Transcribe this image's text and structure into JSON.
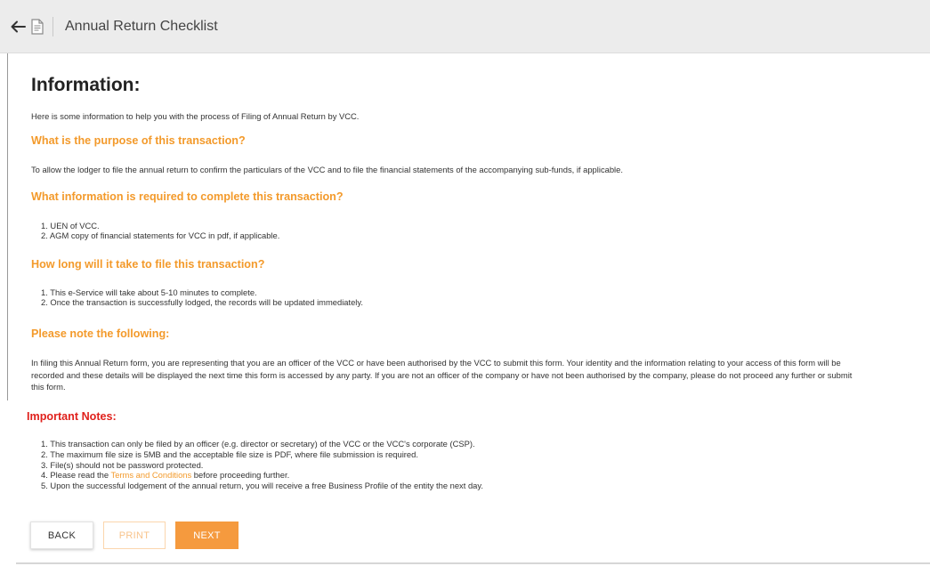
{
  "header": {
    "back_icon": "arrow-left-icon",
    "doc_icon": "document-icon",
    "title": "Annual Return Checklist"
  },
  "info": {
    "heading": "Information:",
    "intro": "Here is some information to help you with the process of Filing of Annual Return by VCC.",
    "purpose_q": "What is the purpose of this transaction?",
    "purpose_a": "To allow the lodger to file the annual return to confirm the particulars of the VCC and to file the financial statements of the accompanying sub-funds, if applicable.",
    "required_q": "What information is required to complete this transaction?",
    "required_items": [
      "1. UEN of VCC.",
      "2. AGM copy of financial statements for VCC in pdf, if applicable."
    ],
    "duration_q": "How long will it take to file this transaction?",
    "duration_items": [
      "1. This e-Service will take about 5-10 minutes to complete.",
      "2. Once the transaction is successfully lodged, the records will be updated immediately."
    ],
    "note_q": "Please note the following:",
    "note_lines": [
      "In filing this Annual Return form, you are representing that you are an officer of the VCC or have been authorised by the VCC to submit this form. Your identity and the information relating to your access of this form will be",
      "recorded and these details will be displayed the next time this form is accessed by any party. If you are not an officer of the company or have not been authorised by the company, please do not proceed any further or submit",
      "this form."
    ]
  },
  "important": {
    "heading": "Important Notes:",
    "item1": "1. This transaction can only be filed by an officer (e.g. director or secretary) of the VCC or the VCC's corporate (CSP).",
    "item2": "2. The maximum file size is 5MB and the acceptable file size is PDF, where file submission is required.",
    "item3": "3. File(s) should not be password protected.",
    "item4_prefix": "4. Please read the ",
    "item4_link": "Terms and Conditions",
    "item4_suffix": " before proceeding further.",
    "item5": "5. Upon the successful lodgement of the annual return, you will receive a free Business Profile of the entity the next day."
  },
  "buttons": {
    "back": "BACK",
    "print": "PRINT",
    "next": "NEXT"
  },
  "colors": {
    "accent": "#f39a2b",
    "next_button": "#f59a3e",
    "important": "#e0211c",
    "header_bg": "#ececec"
  }
}
